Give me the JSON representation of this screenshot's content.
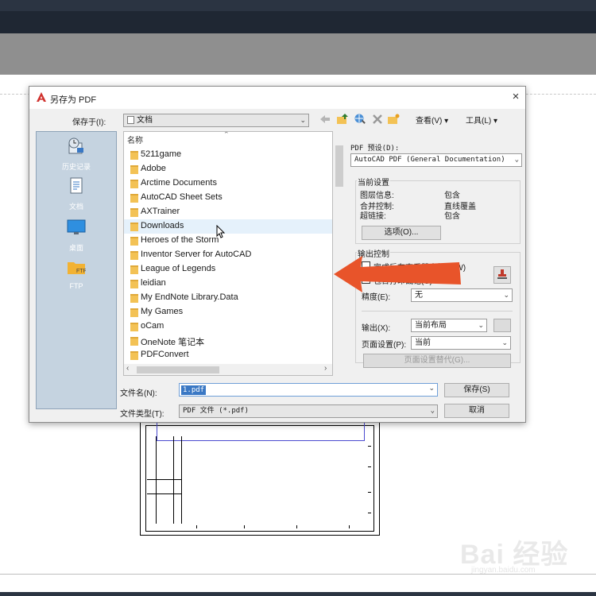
{
  "window": {
    "app_icon": "autocad-logo-icon",
    "title": "另存为 PDF",
    "close": "×"
  },
  "toolbar": {
    "save_in_label": "保存于(I):",
    "save_in_value": "文档",
    "view_label": "查看(V)",
    "tools_label": "工具(L)",
    "icons": [
      "back-icon",
      "up-folder-icon",
      "search-web-icon",
      "delete-icon",
      "new-folder-icon"
    ]
  },
  "places": [
    {
      "label": "历史记录",
      "icon": "history-icon"
    },
    {
      "label": "文档",
      "icon": "documents-icon"
    },
    {
      "label": "桌面",
      "icon": "desktop-icon"
    },
    {
      "label": "FTP",
      "icon": "ftp-icon"
    }
  ],
  "file_list": {
    "column_header": "名称",
    "items": [
      {
        "name": "5211game"
      },
      {
        "name": "Adobe"
      },
      {
        "name": "Arctime Documents"
      },
      {
        "name": "AutoCAD Sheet Sets"
      },
      {
        "name": "AXTrainer"
      },
      {
        "name": "Downloads",
        "hovered": true
      },
      {
        "name": "Heroes of the Storm"
      },
      {
        "name": "Inventor Server for AutoCAD"
      },
      {
        "name": "League of Legends"
      },
      {
        "name": "leidian"
      },
      {
        "name": "My EndNote Library.Data"
      },
      {
        "name": "My Games"
      },
      {
        "name": "oCam"
      },
      {
        "name": "OneNote 笔记本"
      },
      {
        "name": "PDFConvert"
      }
    ]
  },
  "pdf_panel": {
    "preset_label": "PDF 预设(D):",
    "preset_value": "AutoCAD PDF (General Documentation)",
    "current_settings_label": "当前设置",
    "settings": [
      {
        "key": "图层信息:",
        "value": "包含"
      },
      {
        "key": "合并控制:",
        "value": "直线覆盖"
      },
      {
        "key": "超链接:",
        "value": "包含"
      }
    ],
    "options_button": "选项(O)...",
    "output_control_label": "输出控制",
    "open_after_label": "完成后在查看器中打开(W)",
    "include_stamp_label": "包含打印戳记(C)",
    "precision_label": "精度(E):",
    "precision_value": "无",
    "output_label": "输出(X):",
    "output_value": "当前布局",
    "page_setup_label": "页面设置(P):",
    "page_setup_value": "当前",
    "page_setup_override_button": "页面设置替代(G)..."
  },
  "bottom": {
    "filename_label": "文件名(N):",
    "filename_value": "1.pdf",
    "filetype_label": "文件类型(T):",
    "filetype_value": "PDF 文件 (*.pdf)",
    "save_button": "保存(S)",
    "cancel_button": "取消"
  },
  "watermark": {
    "brand": "Bai 经验",
    "url": "jingyan.baidu.com"
  },
  "colors": {
    "places_bg": "#c5d3e0",
    "highlight": "#3a78c4",
    "arrow": "#e8542a",
    "folder": "#f3c255"
  }
}
